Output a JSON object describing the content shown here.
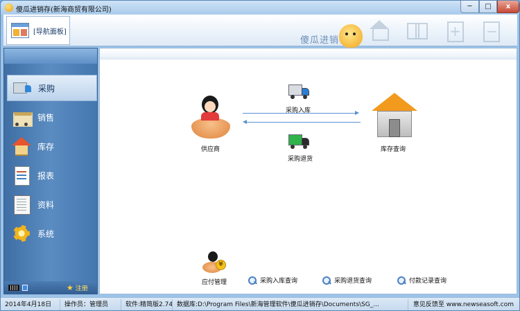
{
  "window": {
    "title": "傻瓜进销存(新海商贸有限公司)",
    "minimize_glyph": "─",
    "maximize_glyph": "□",
    "close_glyph": "x"
  },
  "toolbar": {
    "nav_panel_label": "[导航面板]",
    "brand": "傻瓜进销存",
    "icons": [
      "home-icon",
      "books-icon",
      "add-icon",
      "remove-icon"
    ]
  },
  "sidebar": {
    "items": [
      {
        "label": "采购",
        "icon": "truck-icon",
        "active": true
      },
      {
        "label": "销售",
        "icon": "cart-icon",
        "active": false
      },
      {
        "label": "库存",
        "icon": "house-icon",
        "active": false
      },
      {
        "label": "报表",
        "icon": "report-icon",
        "active": false
      },
      {
        "label": "资料",
        "icon": "document-icon",
        "active": false
      },
      {
        "label": "系统",
        "icon": "gear-icon",
        "active": false
      }
    ],
    "register_label": "注册"
  },
  "main": {
    "supplier_label": "供应商",
    "warehouse_label": "库存查询",
    "purchase_in_label": "采购入库",
    "purchase_return_label": "采购退货",
    "payable_label": "应付管理",
    "payable_coin": "¥",
    "query_links": [
      "采购入库查询",
      "采购退货查询",
      "付款记录查询"
    ]
  },
  "status": {
    "date": "2014年4月18日",
    "operator": "操作员：管理员",
    "version": "软件:精简版2.74,",
    "database": "数据库:D:\\Program Files\\新海管理软件\\傻瓜进销存\\Documents\\SG_...",
    "feedback": "意见反馈至 www.newseasoft.com"
  },
  "colors": {
    "sidebar_bg": "#4a7db4",
    "arrow": "#5b8fd4",
    "accent": "#f29a1e"
  }
}
